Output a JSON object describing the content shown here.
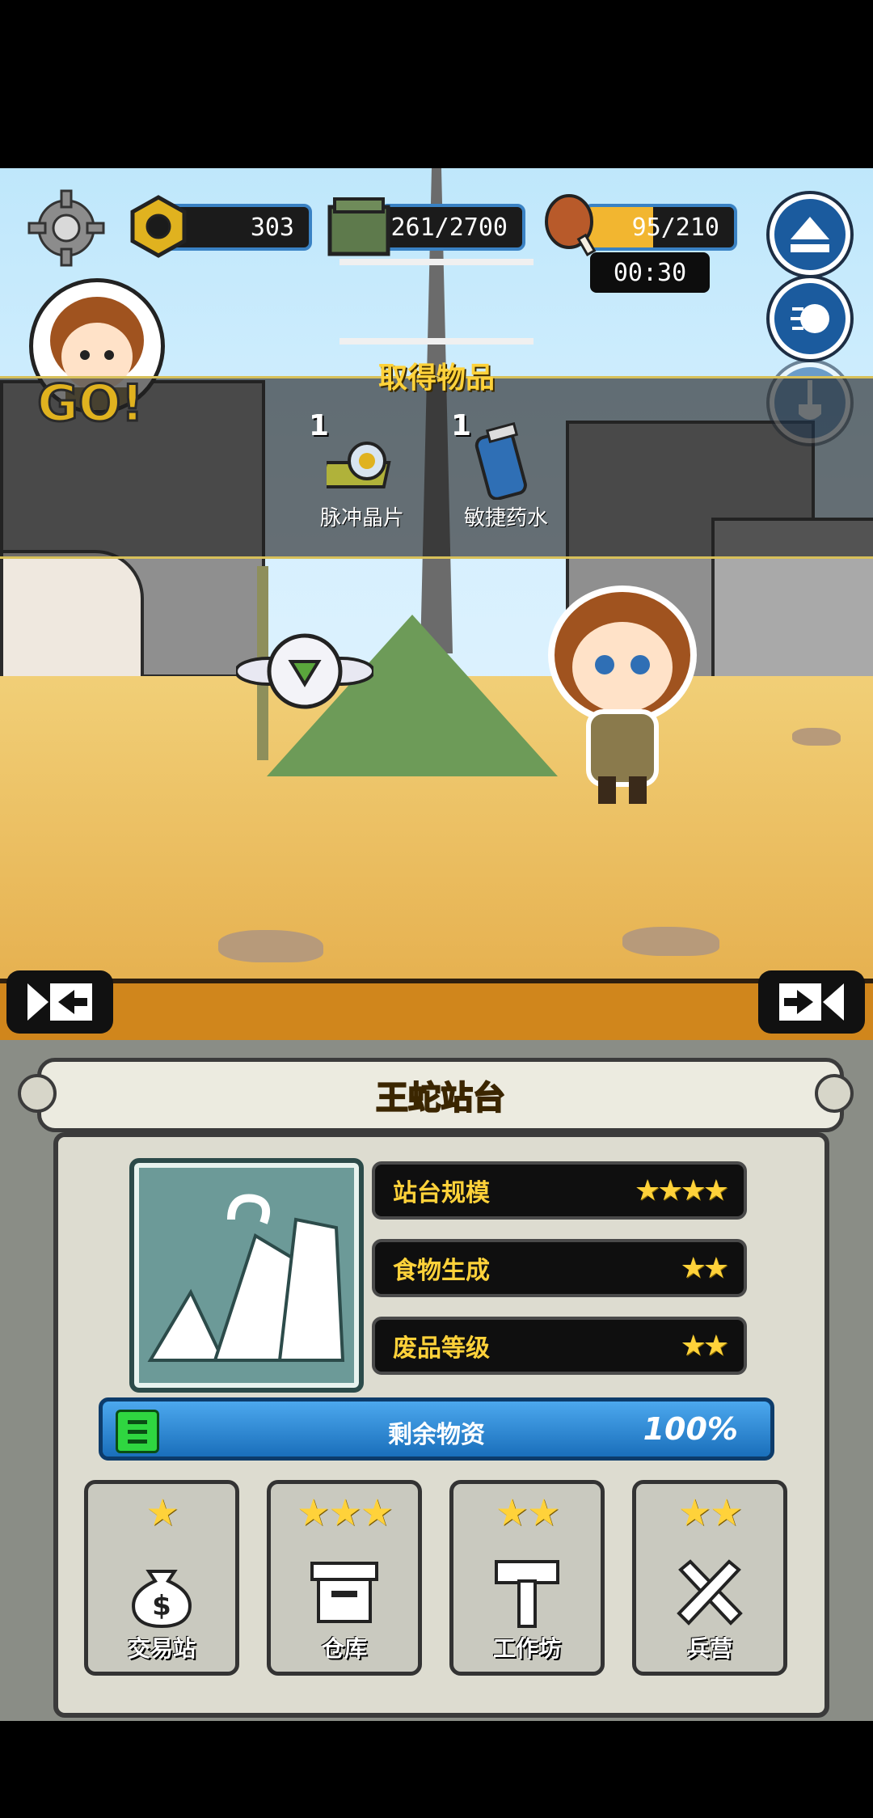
{
  "hud": {
    "bolts": "303",
    "supplies": "261/2700",
    "food": "95/210",
    "food_fill": 0.45,
    "timer": "00:30"
  },
  "character": {
    "go_text": "GO!"
  },
  "item_panel": {
    "title": "取得物品",
    "items": [
      {
        "count": "1",
        "label": "脉冲晶片",
        "icon": "chip-icon"
      },
      {
        "count": "1",
        "label": "敏捷药水",
        "icon": "potion-icon"
      }
    ]
  },
  "station": {
    "title": "王蛇站台",
    "stats": [
      {
        "label": "站台规模",
        "stars": 4
      },
      {
        "label": "食物生成",
        "stars": 2
      },
      {
        "label": "废品等级",
        "stars": 2
      }
    ],
    "remaining": {
      "label": "剩余物资",
      "percent": "100%",
      "fraction": 1.0
    },
    "buildings": [
      {
        "label": "交易站",
        "stars": 1,
        "icon": "money-bag-icon"
      },
      {
        "label": "仓库",
        "stars": 3,
        "icon": "storage-icon"
      },
      {
        "label": "工作坊",
        "stars": 2,
        "icon": "hammer-icon"
      },
      {
        "label": "兵营",
        "stars": 2,
        "icon": "crossed-swords-icon"
      }
    ]
  },
  "colors": {
    "accent": "#ffd23a",
    "hud_border": "#3a82c4",
    "progress": "#1e7fd0"
  }
}
